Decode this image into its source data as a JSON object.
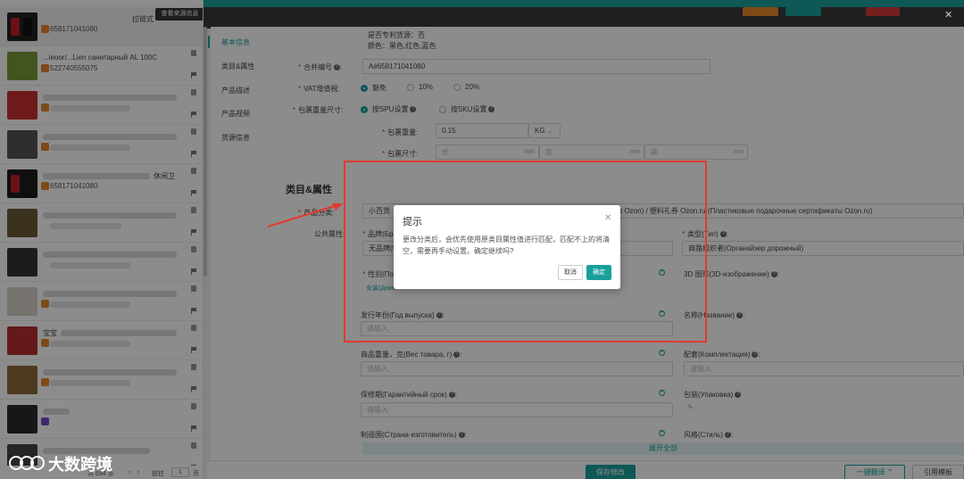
{
  "sidebar": {
    "source_tip": "查看来源信息",
    "items": [
      {
        "title": "拉链式",
        "code": "658171041080"
      },
      {
        "title": "...ieoor/...Lien санитарный AL 100C",
        "code": "522740555075"
      },
      {
        "title": "",
        "code": ""
      },
      {
        "title": "",
        "code": ""
      },
      {
        "title": "休闲卫",
        "code": "658171041080"
      },
      {
        "title": "",
        "code": ""
      },
      {
        "title": "",
        "code": ""
      },
      {
        "title": "",
        "code": ""
      },
      {
        "title": "宝宝",
        "code": ""
      },
      {
        "title": "",
        "code": ""
      },
      {
        "title": "",
        "code": ""
      },
      {
        "title": "",
        "code": ""
      }
    ],
    "pager": {
      "total": "共 694 条",
      "goto": "前往",
      "page": "1",
      "page_suffix": "页"
    }
  },
  "anchors": [
    "基本信息",
    "类目&属性",
    "产品描述",
    "产品视频",
    "货源信息"
  ],
  "basic": {
    "patent_line": "是否专利货源：否",
    "color_line": "颜色：黑色,红色,蓝色",
    "merge_label": "合并编号",
    "merge_value": "A#658171041080",
    "vat_label": "VAT增值税:",
    "vat_options": [
      "豁免",
      "10%",
      "20%"
    ],
    "pkg_label": "包裹重量尺寸:",
    "pkg_options": [
      "按SPU设置",
      "按SKU设置"
    ],
    "weight_label": "包裹重量:",
    "weight_value": "0.15",
    "weight_unit": "KG",
    "size_label": "包裹尺寸:",
    "size_placeholders": [
      "长",
      "宽",
      "高"
    ],
    "size_unit": "mm"
  },
  "category": {
    "section_title": "类目&属性",
    "cat_label": "产品分类:",
    "cat_value": "小百货",
    "cat_tail": "t Ozon) / 塑料礼券 Ozon.ru (Пластиковые подарочные сертификаты Ozon.ru)",
    "public_attr_label": "公共属性:",
    "brand_label": "品牌(Бре",
    "brand_value": "无品牌(!",
    "type_label": "类型(Тип)",
    "type_value": "商路组织者(Органайзер дорожный)",
    "gender_label": "性别(Пол",
    "gender_chip": "女装(Даме",
    "figure_label": "3D 图形(3D-изображение)",
    "year_label": "发行年份(Год выпуска)",
    "year_placeholder": "请输入",
    "name_label": "名称(Название)",
    "weight_label": "商品重量，克(Вес товара, г)",
    "weight_placeholder": "请输入",
    "kit_label": "配套(Комплектация)",
    "kit_placeholder": "请输入",
    "warranty_label": "保修期(Гарантийный срок)",
    "warranty_placeholder": "请输入",
    "pack_label": "包装(Упаковка)",
    "country_label": "制造国(Страна-изготовитель)",
    "style_label": "风格(Стиль)",
    "expand_all": "展开全部"
  },
  "bottom": {
    "save": "保存修改",
    "translate": "一键翻译",
    "template": "引用模板"
  },
  "dialog": {
    "title": "提示",
    "message": "更改分类后，会优先使用原类目属性值进行匹配，匹配不上的将清空，需要再手动设置。确定继续吗?",
    "cancel": "取消",
    "confirm": "确定"
  },
  "watermark": "大数跨境",
  "colors": {
    "accent": "#1aa09c",
    "annotation": "#e23b2e",
    "overlay": "rgba(0,0,0,0.45)"
  }
}
